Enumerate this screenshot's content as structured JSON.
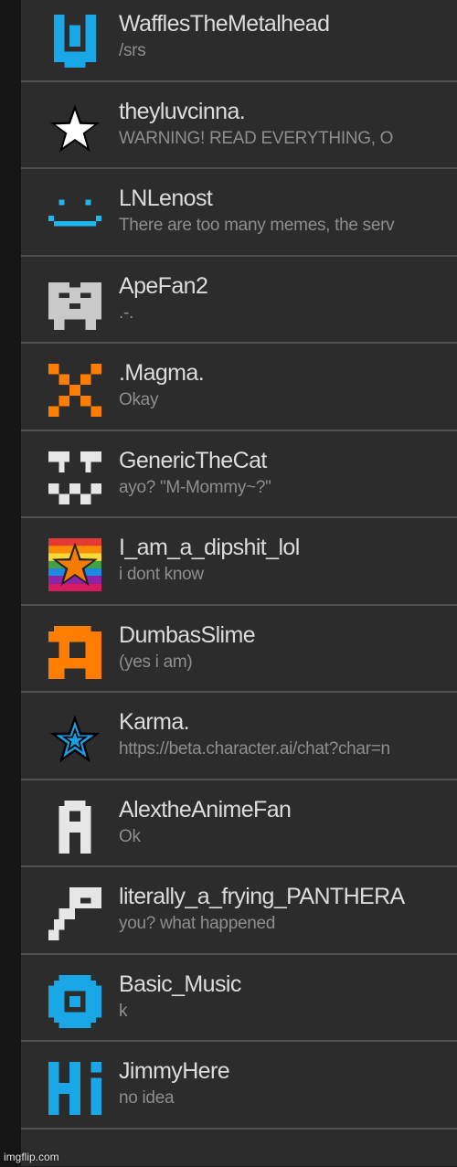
{
  "colors": {
    "row_bg": "#2c2c2c",
    "divider": "#515151",
    "name_text": "#dcdcdc",
    "status_text": "#8e8e8e",
    "left_strip": "#151515"
  },
  "users": [
    {
      "name": "WafflesTheMetalhead",
      "status": "/srs",
      "icon": "blue-pixel-u-icon"
    },
    {
      "name": "theyluvcinna.",
      "status": "WARNING! READ EVERYTHING, O",
      "icon": "white-star-icon"
    },
    {
      "name": "LNLenost",
      "status": "There are too many memes, the serv",
      "icon": "blue-smiley-icon"
    },
    {
      "name": "ApeFan2",
      "status": ".-.",
      "icon": "gray-pixel-face-icon"
    },
    {
      "name": ".Magma.",
      "status": "Okay",
      "icon": "orange-x-icon"
    },
    {
      "name": "GenericTheCat",
      "status": "ayo? \"M-Mommy~?\"",
      "icon": "white-cat-face-icon"
    },
    {
      "name": "I_am_a_dipshit_lol",
      "status": "i dont know",
      "icon": "rainbow-star-icon"
    },
    {
      "name": "DumbasSlime",
      "status": "(yes i am)",
      "icon": "orange-slime-icon"
    },
    {
      "name": "Karma.",
      "status": "https://beta.character.ai/chat?char=n",
      "icon": "blue-star-icon"
    },
    {
      "name": "AlextheAnimeFan",
      "status": "Ok",
      "icon": "white-pixel-a-icon"
    },
    {
      "name": "literally_a_frying_PANTHERA",
      "status": "you? what happened",
      "icon": "white-pixel-p-icon"
    },
    {
      "name": "Basic_Music",
      "status": "k",
      "icon": "blue-ring-icon"
    },
    {
      "name": "JimmyHere",
      "status": "no idea",
      "icon": "blue-hi-icon"
    }
  ],
  "watermark": "imgflip.com"
}
